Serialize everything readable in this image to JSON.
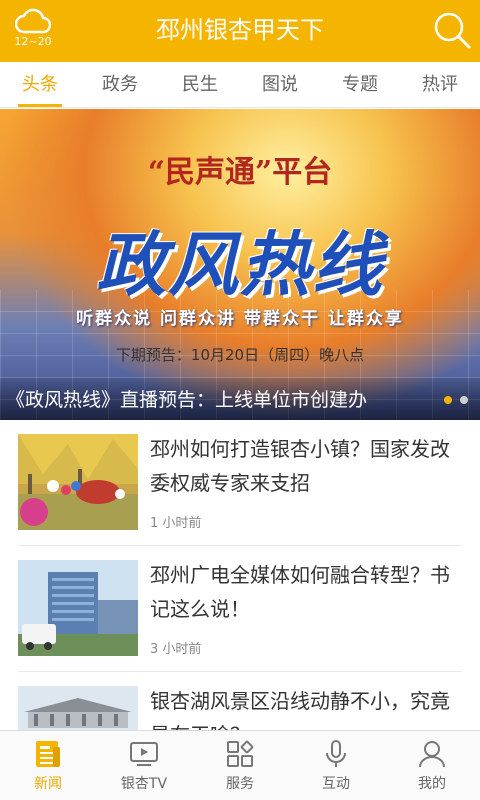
{
  "header": {
    "title": "邳州银杏甲天下",
    "weather_temp": "12~20",
    "weather_icon": "cloud-icon",
    "search_icon": "search-icon",
    "brand_color": "#f5b400"
  },
  "tabs": [
    {
      "label": "头条",
      "active": true
    },
    {
      "label": "政务",
      "active": false
    },
    {
      "label": "民生",
      "active": false
    },
    {
      "label": "图说",
      "active": false
    },
    {
      "label": "专题",
      "active": false
    },
    {
      "label": "热评",
      "active": false
    }
  ],
  "banner": {
    "platform": "“民声通”平台",
    "title": "政风热线",
    "slogan": "听群众说 问群众讲 带群众干 让群众享",
    "notice": "下期预告：10月20日（周四）晚八点",
    "caption": "《政风热线》直播预告：上线单位市创建办",
    "slide_count": 2,
    "active_slide": 1
  },
  "articles": [
    {
      "headline": "邳州如何打造银杏小镇？国家发改委权威专家来支招",
      "time": "1 小时前"
    },
    {
      "headline": "邳州广电全媒体如何融合转型？书记这么说！",
      "time": "3 小时前"
    },
    {
      "headline": "银杏湖风景区沿线动静不小，究竟是在干啥？",
      "time": ""
    }
  ],
  "bottom_nav": [
    {
      "label": "新闻",
      "icon": "news-icon",
      "active": true
    },
    {
      "label": "银杏TV",
      "icon": "tv-icon",
      "active": false
    },
    {
      "label": "服务",
      "icon": "services-icon",
      "active": false
    },
    {
      "label": "互动",
      "icon": "microphone-icon",
      "active": false
    },
    {
      "label": "我的",
      "icon": "profile-icon",
      "active": false
    }
  ]
}
